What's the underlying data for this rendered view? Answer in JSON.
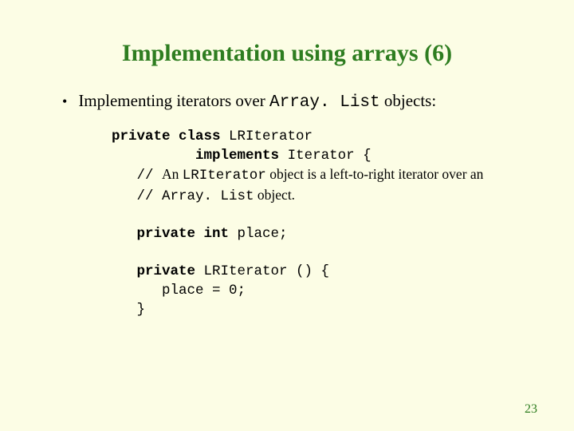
{
  "title": "Implementation using arrays (6)",
  "bullet": {
    "pre": "Implementing iterators over ",
    "mono": "Array. List",
    "post": " objects:"
  },
  "code": {
    "l1a": "private class",
    "l1b": " LRIterator",
    "l2a": "implements",
    "l2b": " Iterator {",
    "l3a": "   // ",
    "l3b": "An ",
    "l3c": "LRIterator",
    "l3d": " object is a left-to-right iterator over an",
    "l4a": "   // ",
    "l4b": "Array. List",
    "l4c": " object.",
    "blank": " ",
    "l5a": "private int",
    "l5b": " place;",
    "l6a": "private",
    "l6b": " LRIterator () {",
    "l7": "      place = 0;",
    "l8": "   }"
  },
  "pageNumber": "23"
}
